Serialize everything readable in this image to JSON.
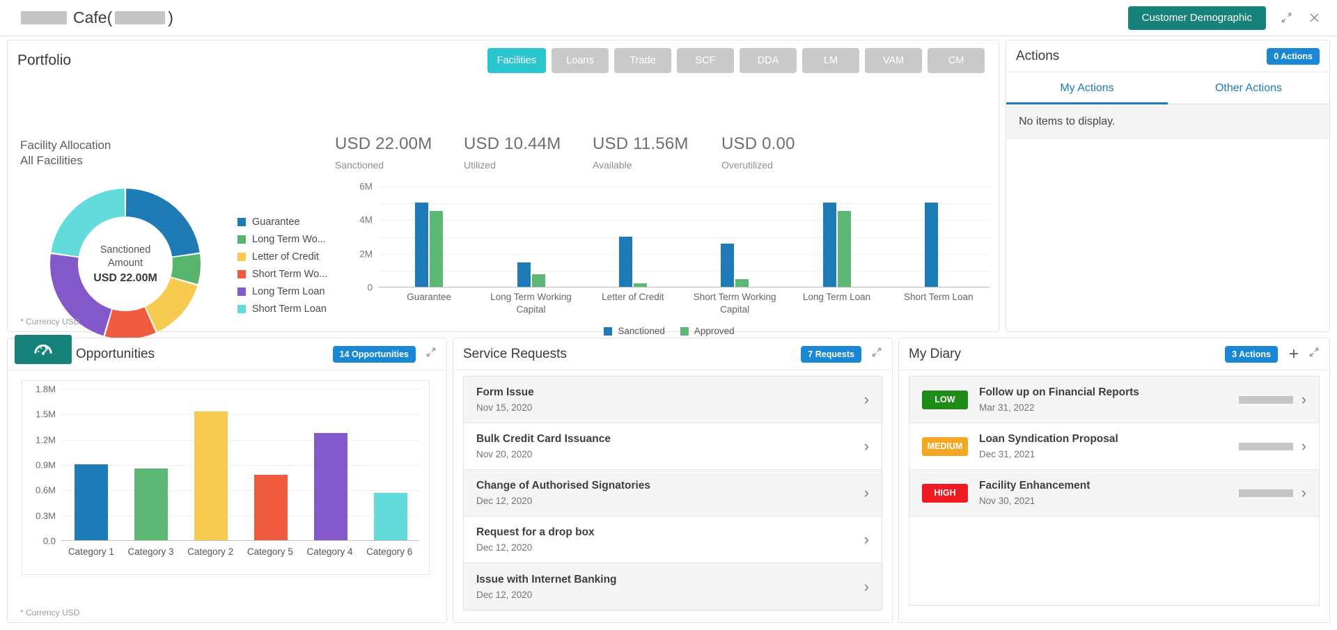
{
  "topbar": {
    "title_suffix": "Cafe(",
    "title_close": ")",
    "demographic_button": "Customer Demographic",
    "collapse_icon": "collapse-arrows-icon",
    "close_icon": "close-icon"
  },
  "portfolio": {
    "title": "Portfolio",
    "tabs": [
      {
        "label": "Facilities",
        "active": true
      },
      {
        "label": "Loans",
        "active": false
      },
      {
        "label": "Trade",
        "active": false
      },
      {
        "label": "SCF",
        "active": false
      },
      {
        "label": "DDA",
        "active": false
      },
      {
        "label": "LM",
        "active": false
      },
      {
        "label": "VAM",
        "active": false
      },
      {
        "label": "CM",
        "active": false
      }
    ],
    "allocation_title": "Facility Allocation",
    "allocation_subtitle": "All Facilities",
    "currency_note": "* Currency USD",
    "kpis": [
      {
        "value": "USD 22.00M",
        "label": "Sanctioned"
      },
      {
        "value": "USD 10.44M",
        "label": "Utilized"
      },
      {
        "value": "USD 11.56M",
        "label": "Available"
      },
      {
        "value": "USD 0.00",
        "label": "Overutilized"
      }
    ]
  },
  "chart_data": [
    {
      "type": "pie",
      "name": "facility-allocation-donut",
      "title": "Facility Allocation",
      "subtitle": "All Facilities",
      "center_label": "Sanctioned Amount",
      "center_value": "USD 22.00M",
      "legend_position": "right",
      "labels": [
        "Guarantee",
        "Long Term Wo...",
        "Letter of Credit",
        "Short Term Wo...",
        "Long Term Loan",
        "Short Term Loan"
      ],
      "values": [
        5.0,
        1.5,
        3.0,
        2.5,
        5.0,
        5.0
      ],
      "colors": [
        "#1f7bb6",
        "#58b56e",
        "#f6cb4f",
        "#ef5b3f",
        "#8358c9",
        "#63dbdb"
      ]
    },
    {
      "type": "bar",
      "name": "facility-sanctioned-approved-bar",
      "categories": [
        "Guarantee",
        "Long Term Working Capital",
        "Letter of Credit",
        "Short Term Working Capital",
        "Long Term Loan",
        "Short Term Loan"
      ],
      "series": [
        {
          "name": "Sanctioned",
          "color": "#1f7bb6",
          "values": [
            5.0,
            1.45,
            3.0,
            2.55,
            5.0,
            5.0
          ]
        },
        {
          "name": "Approved",
          "color": "#5cb874",
          "values": [
            4.5,
            0.75,
            0.2,
            0.45,
            4.5,
            0
          ]
        }
      ],
      "ylim": [
        0,
        6
      ],
      "yticks": [
        0,
        2000000,
        4000000,
        6000000
      ],
      "ytick_labels": [
        "0",
        "2M",
        "4M",
        "6M"
      ],
      "ylabel": "",
      "xlabel": "",
      "grid": true,
      "legend_position": "bottom"
    },
    {
      "type": "bar",
      "name": "opportunities-bar",
      "categories": [
        "Category 1",
        "Category 3",
        "Category 2",
        "Category 5",
        "Category 4",
        "Category 6"
      ],
      "values": [
        0.9,
        0.85,
        1.53,
        0.78,
        1.27,
        0.56
      ],
      "colors": [
        "#1f7bb6",
        "#5cb874",
        "#f6cb4f",
        "#ef5b3f",
        "#8358c9",
        "#63dbdb"
      ],
      "ylim": [
        0,
        1.8
      ],
      "yticks": [
        0.0,
        0.3,
        0.6,
        0.9,
        1.2,
        1.5,
        1.8
      ],
      "ytick_labels": [
        "0.0",
        "0.3M",
        "0.6M",
        "0.9M",
        "1.2M",
        "1.5M",
        "1.8M"
      ],
      "ylabel": "",
      "xlabel": "",
      "title": "",
      "grid": true,
      "currency_note": "* Currency USD"
    }
  ],
  "actions": {
    "title": "Actions",
    "badge": "0 Actions",
    "tabs": [
      {
        "label": "My Actions",
        "active": true
      },
      {
        "label": "Other Actions",
        "active": false
      }
    ],
    "empty_text": "No items to display."
  },
  "opportunities": {
    "title": "Opportunities",
    "badge": "14 Opportunities",
    "gauge_icon": "gauge-icon",
    "currency_note": "* Currency USD"
  },
  "service_requests": {
    "title": "Service Requests",
    "badge": "7 Requests",
    "items": [
      {
        "title": "Form Issue",
        "date": "Nov 15, 2020"
      },
      {
        "title": "Bulk Credit Card Issuance",
        "date": "Nov 20, 2020"
      },
      {
        "title": "Change of Authorised Signatories",
        "date": "Dec 12, 2020"
      },
      {
        "title": "Request for a drop box",
        "date": "Dec 12, 2020"
      },
      {
        "title": "Issue with Internet Banking",
        "date": "Dec 12, 2020"
      }
    ]
  },
  "diary": {
    "title": "My Diary",
    "badge": "3 Actions",
    "add_icon": "plus-icon",
    "items": [
      {
        "priority": "LOW",
        "color": "#1f8b18",
        "title": "Follow up on Financial Reports",
        "date": "Mar 31, 2022"
      },
      {
        "priority": "MEDIUM",
        "color": "#f5a623",
        "title": "Loan Syndication Proposal",
        "date": "Dec 31, 2021"
      },
      {
        "priority": "HIGH",
        "color": "#ee1b24",
        "title": "Facility Enhancement",
        "date": "Nov 30, 2021"
      }
    ]
  }
}
